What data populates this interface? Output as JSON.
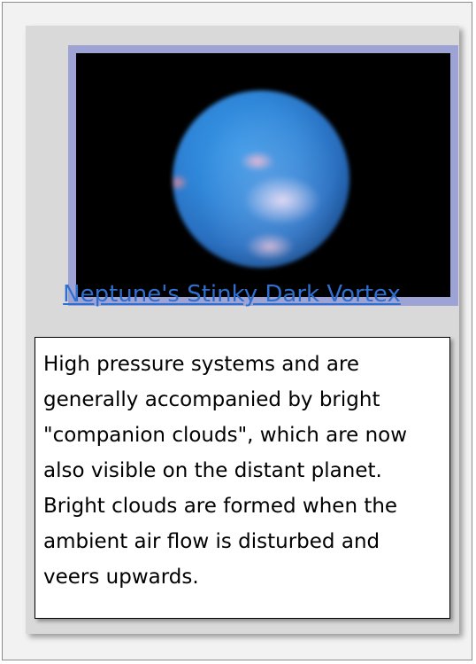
{
  "card": {
    "image_alt": "Neptune planet image",
    "title": "Neptune's Stinky Dark Vortex",
    "body": "High pressure systems and are generally accompanied by bright \"companion clouds\", which are now also visible on the distant planet. Bright clouds are formed when the ambient air flow is disturbed and veers upwards."
  },
  "colors": {
    "link": "#2f6fcf",
    "frame": "#9ea3d6",
    "card_background": "#d9d9d9"
  }
}
